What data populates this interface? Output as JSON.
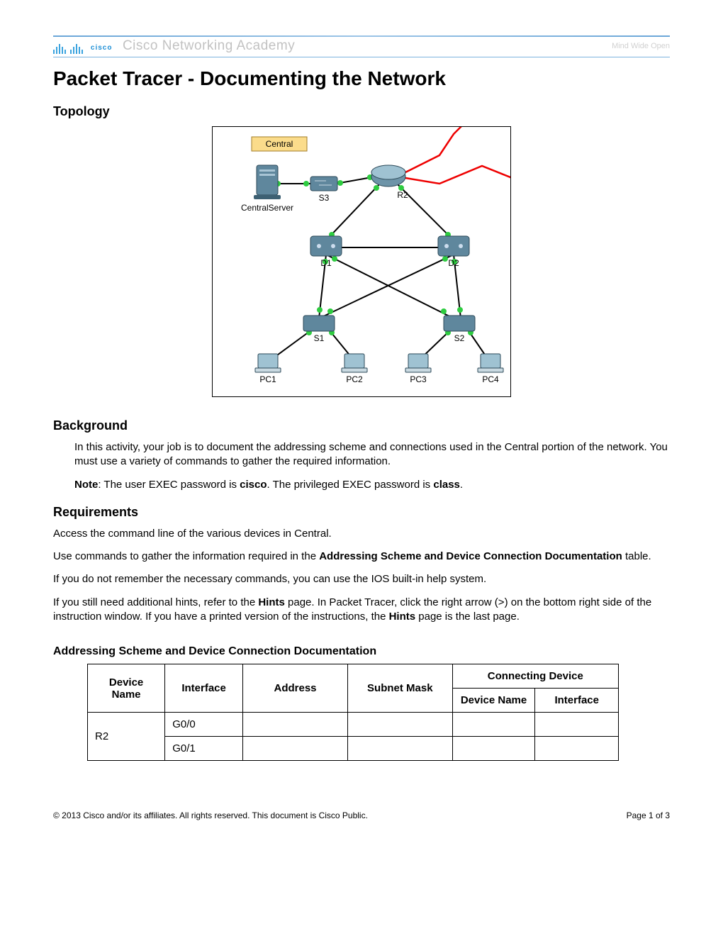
{
  "header": {
    "logo_text": "cisco",
    "academy": "Cisco Networking Academy",
    "tagline": "Mind Wide Open"
  },
  "title": "Packet Tracer - Documenting the Network",
  "sections": {
    "topology": "Topology",
    "background": "Background",
    "requirements": "Requirements",
    "table_heading": "Addressing Scheme and Device Connection Documentation"
  },
  "topology": {
    "cloud_label": "Central",
    "devices": {
      "server": "CentralServer",
      "s3": "S3",
      "r2": "R2",
      "d1": "D1",
      "d2": "D2",
      "s1": "S1",
      "s2": "S2",
      "pc1": "PC1",
      "pc2": "PC2",
      "pc3": "PC3",
      "pc4": "PC4"
    }
  },
  "background": {
    "p1": "In this activity, your job is to document the addressing scheme and connections used in the Central portion of the network. You must use a variety of commands to gather the required information.",
    "note_label": "Note",
    "note_1": ": The user EXEC password is ",
    "note_pw1": "cisco",
    "note_2": ". The privileged EXEC password is ",
    "note_pw2": "class",
    "note_3": "."
  },
  "requirements": {
    "p1": "Access the command line of the various devices in Central.",
    "p2_a": "Use commands to gather the information required in the ",
    "p2_b": "Addressing Scheme and Device Connection Documentation",
    "p2_c": " table.",
    "p3": "If you do not remember the necessary commands, you can use the IOS built-in help system.",
    "p4_a": "If you still need additional hints, refer to the ",
    "p4_b": "Hints",
    "p4_c": " page. In Packet Tracer, click the right arrow (>) on the bottom right side of the instruction window. If you have a printed version of the instructions, the ",
    "p4_d": "Hints",
    "p4_e": " page is the last page."
  },
  "table": {
    "headers": {
      "device_name": "Device Name",
      "interface": "Interface",
      "address": "Address",
      "subnet_mask": "Subnet Mask",
      "connecting_device": "Connecting Device",
      "c_device_name": "Device Name",
      "c_interface": "Interface"
    },
    "rows": [
      {
        "device": "R2",
        "interface": "G0/0",
        "address": "",
        "mask": "",
        "c_device": "",
        "c_interface": ""
      },
      {
        "device": "",
        "interface": "G0/1",
        "address": "",
        "mask": "",
        "c_device": "",
        "c_interface": ""
      }
    ]
  },
  "footer": {
    "copyright": "© 2013 Cisco and/or its affiliates. All rights reserved. This document is Cisco Public.",
    "page": "Page 1 of 3"
  }
}
